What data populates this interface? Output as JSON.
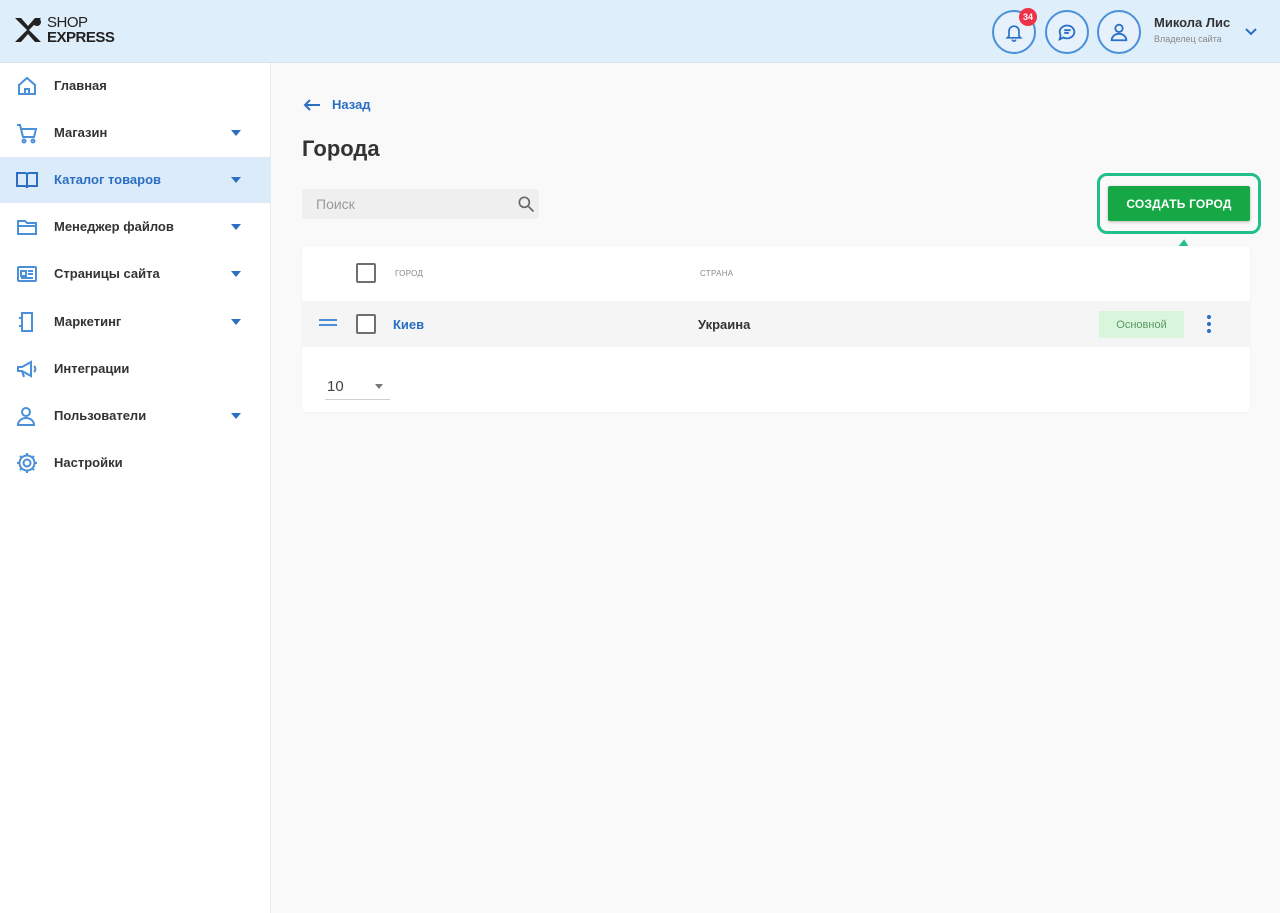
{
  "header": {
    "logo": {
      "line1": "SHOP",
      "line2": "EXPRESS"
    },
    "notifications": {
      "icon": "bell-icon",
      "count": "34"
    },
    "messages": {
      "icon": "chat-icon"
    },
    "profile": {
      "icon": "user-icon"
    },
    "user": {
      "name": "Микола Лис",
      "role": "Владелец сайта"
    }
  },
  "sidebar": {
    "items": [
      {
        "label": "Главная",
        "icon": "home-icon",
        "has_submenu": false,
        "active": false
      },
      {
        "label": "Магазин",
        "icon": "cart-icon",
        "has_submenu": true,
        "active": false
      },
      {
        "label": "Каталог товаров",
        "icon": "book-icon",
        "has_submenu": true,
        "active": true
      },
      {
        "label": "Менеджер файлов",
        "icon": "folder-icon",
        "has_submenu": true,
        "active": false
      },
      {
        "label": "Страницы сайта",
        "icon": "pages-icon",
        "has_submenu": true,
        "active": false
      },
      {
        "label": "Маркетинг",
        "icon": "marketing-icon",
        "has_submenu": true,
        "active": false
      },
      {
        "label": "Интеграции",
        "icon": "megaphone-icon",
        "has_submenu": false,
        "active": false
      },
      {
        "label": "Пользователи",
        "icon": "users-icon",
        "has_submenu": true,
        "active": false
      },
      {
        "label": "Настройки",
        "icon": "gear-icon",
        "has_submenu": false,
        "active": false
      }
    ]
  },
  "main": {
    "back_label": "Назад",
    "title": "Города",
    "search": {
      "placeholder": "Поиск",
      "value": ""
    },
    "create_button": "СОЗДАТЬ ГОРОД",
    "table": {
      "columns": [
        "ГОРОД",
        "СТРАНА"
      ],
      "rows": [
        {
          "city": "Киев",
          "country": "Украина",
          "status": "Основной"
        }
      ]
    },
    "pagination": {
      "page_size": "10"
    }
  },
  "colors": {
    "header_bg": "#dfeefb",
    "accent": "#2a6fc4",
    "create_button": "#15a845",
    "highlight_frame": "#21c08b",
    "badge": "#f0314a"
  }
}
